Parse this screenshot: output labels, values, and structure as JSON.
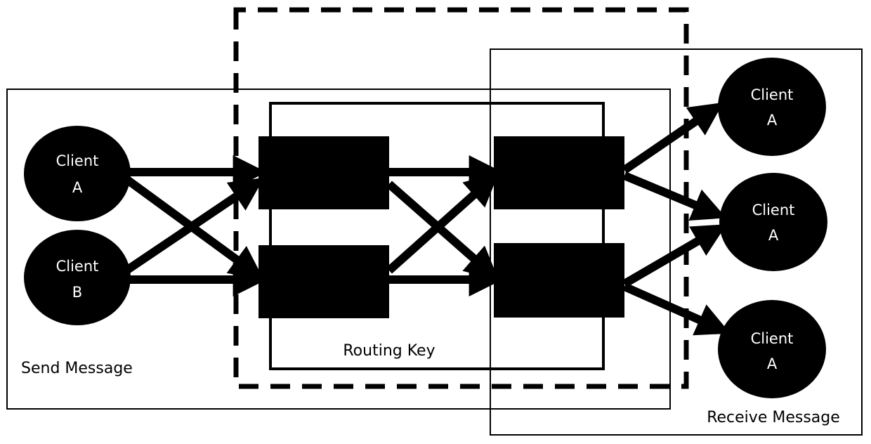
{
  "diagram": {
    "regions": {
      "send": "Send Message",
      "routing": "Routing Key",
      "receive": "Receive Message"
    },
    "senders": [
      {
        "line1": "Client",
        "line2": "A"
      },
      {
        "line1": "Client",
        "line2": "B"
      }
    ],
    "receivers": [
      {
        "line1": "Client",
        "line2": "A"
      },
      {
        "line1": "Client",
        "line2": "A"
      },
      {
        "line1": "Client",
        "line2": "A"
      }
    ],
    "colors": {
      "ink": "#000000",
      "background": "#ffffff",
      "client_text": "#ffffff"
    }
  }
}
